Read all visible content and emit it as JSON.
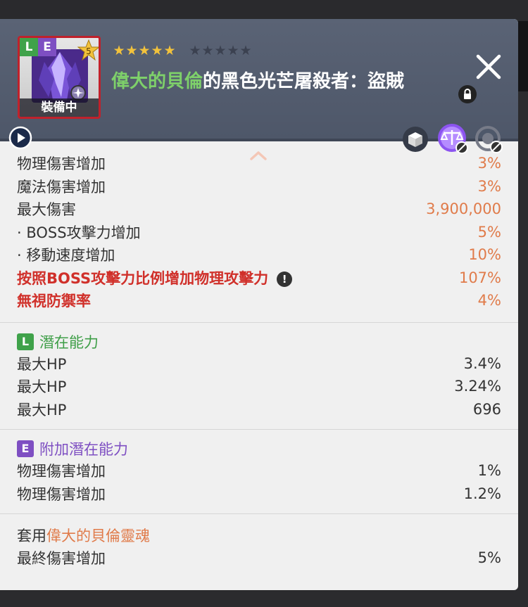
{
  "item": {
    "badge_l": "L",
    "badge_e": "E",
    "star_force": "5",
    "equip_status": "裝備中",
    "stars_total": 10,
    "stars_filled": 5,
    "title_prefix": "偉大的貝倫",
    "title_suffix": "的黑色光芒屠殺者：盜賊"
  },
  "main_stats": [
    {
      "label": "物理傷害增加",
      "value": "3%"
    },
    {
      "label": "魔法傷害增加",
      "value": "3%"
    },
    {
      "label": "最大傷害",
      "value": "3,900,000"
    },
    {
      "label": "· BOSS攻擊力增加",
      "value": "5%"
    },
    {
      "label": "· 移動速度增加",
      "value": "10%"
    },
    {
      "label": "按照BOSS攻擊力比例增加物理攻擊力",
      "value": "107%",
      "info": "!"
    },
    {
      "label": "無視防禦率",
      "value": "4%"
    }
  ],
  "potential": {
    "badge": "L",
    "title": "潛在能力",
    "rows": [
      {
        "label": "最大HP",
        "value": "3.4%"
      },
      {
        "label": "最大HP",
        "value": "3.24%"
      },
      {
        "label": "最大HP",
        "value": "696"
      }
    ]
  },
  "additional_potential": {
    "badge": "E",
    "title": "附加潛在能力",
    "rows": [
      {
        "label": "物理傷害增加",
        "value": "1%"
      },
      {
        "label": "物理傷害增加",
        "value": "1.2%"
      }
    ]
  },
  "set_bonus": {
    "prefix": "套用",
    "set_name": "偉大的貝倫靈魂",
    "rows": [
      {
        "label": "最終傷害增加",
        "value": "5%"
      }
    ]
  },
  "colors": {
    "green": "#7ed06a",
    "orange": "#e07b4a",
    "red": "#d0302a",
    "purple": "#7e4fc2"
  },
  "icons": [
    "play-icon",
    "lock-icon",
    "close-icon",
    "box-icon",
    "scale-icon",
    "transfer-icon",
    "chevron-up-icon",
    "info-icon"
  ]
}
